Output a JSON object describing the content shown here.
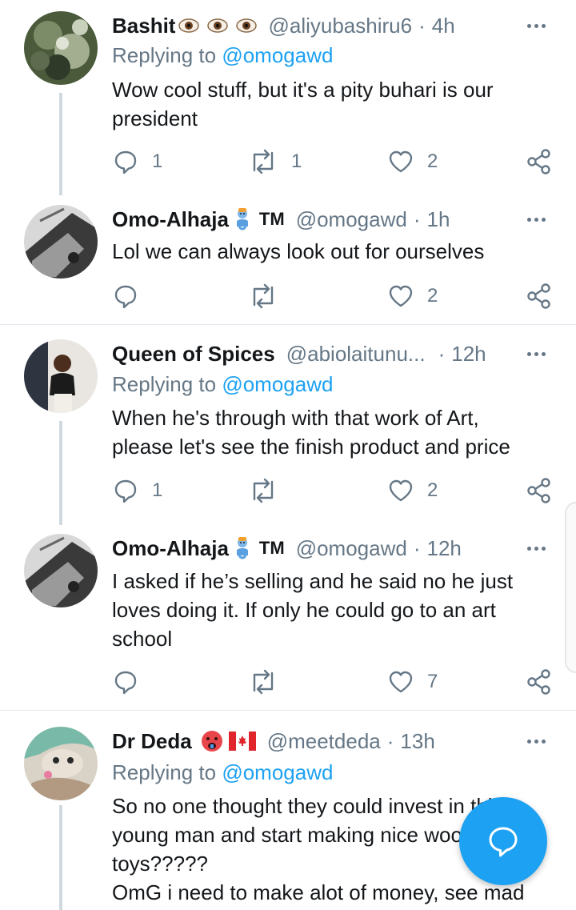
{
  "tweets": [
    {
      "name": "Bashit",
      "emojis": [
        "eye-emoji",
        "eye-emoji",
        "eye-emoji"
      ],
      "handle": "@aliyubashiru6",
      "time": "4h",
      "replying_prefix": "Replying to",
      "replying_mention": "@omogawd",
      "text": "Wow cool stuff, but it's a pity buhari is our\npresident",
      "replies": "1",
      "retweets": "1",
      "likes": "2"
    },
    {
      "name": "Omo-Alhaja",
      "emojis": [
        "genie-emoji",
        "tm-symbol"
      ],
      "tm": "TM",
      "handle": "@omogawd",
      "time": "1h",
      "text": "Lol we can always look out for ourselves",
      "replies": "",
      "retweets": "",
      "likes": "2"
    },
    {
      "name": "Queen of Spices",
      "emojis": [],
      "handle": "@abiolaitunu...",
      "time": "12h",
      "replying_prefix": "Replying to",
      "replying_mention": "@omogawd",
      "text": "When he's through with that work of Art,\nplease let's see the finish product and price",
      "replies": "1",
      "retweets": "",
      "likes": "2"
    },
    {
      "name": "Omo-Alhaja",
      "emojis": [
        "genie-emoji",
        "tm-symbol"
      ],
      "tm": "TM",
      "handle": "@omogawd",
      "time": "12h",
      "text": "I asked if he’s selling and he said no he just\nloves doing it. If only he could go to an art\nschool",
      "replies": "",
      "retweets": "",
      "likes": "7"
    },
    {
      "name": "Dr Deda",
      "emojis": [
        "hot-face-emoji",
        "canada-flag-emoji"
      ],
      "handle": "@meetdeda",
      "time": "13h",
      "replying_prefix": "Replying to",
      "replying_mention": "@omogawd",
      "text": "So no one thought they could invest in this\nyoung man and start making nice wooden\ntoys?????\nOmG i need to make alot of money, see mad",
      "replies": "",
      "retweets": "",
      "likes": ""
    }
  ],
  "separator": "·",
  "colors": {
    "accent": "#1da1f2",
    "muted": "#657786",
    "text": "#14171a",
    "divider": "#e1e8ed",
    "thread_line": "#cfd9de"
  },
  "fab": {
    "icon": "compose-reply-icon"
  }
}
